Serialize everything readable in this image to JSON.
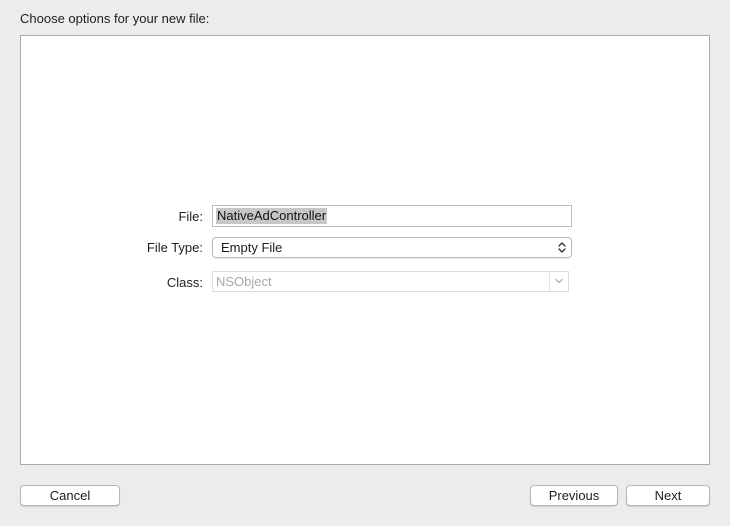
{
  "dialog": {
    "heading": "Choose options for your new file:"
  },
  "form": {
    "file_label": "File:",
    "file_value": "NativeAdController",
    "file_type_label": "File Type:",
    "file_type_value": "Empty File",
    "class_label": "Class:",
    "class_value": "NSObject"
  },
  "buttons": {
    "cancel": "Cancel",
    "previous": "Previous",
    "next": "Next"
  },
  "icons": {
    "file_type_popup": "up-down-chevron-icon",
    "class_combo": "chevron-down-icon"
  }
}
